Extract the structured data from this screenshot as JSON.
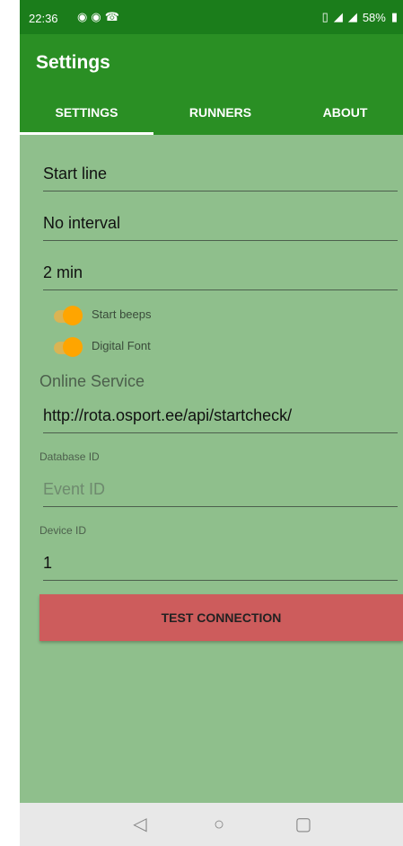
{
  "status": {
    "time": "22:36",
    "battery": "58%",
    "icons_left": [
      "messenger-icon",
      "messenger-icon",
      "missed-call-icon"
    ],
    "icons_right": [
      "vibrate-icon",
      "data-4g-icon",
      "signal-icon",
      "battery-icon"
    ]
  },
  "appbar": {
    "title": "Settings",
    "tabs": [
      {
        "label": "SETTINGS",
        "selected": true
      },
      {
        "label": "RUNNERS",
        "selected": false
      },
      {
        "label": "ABOUT",
        "selected": false
      }
    ]
  },
  "settings": {
    "start_line": "Start line",
    "interval": "No interval",
    "duration": "2 min",
    "start_beeps": {
      "label": "Start beeps",
      "on": true
    },
    "digital_font": {
      "label": "Digital Font",
      "on": true
    },
    "online_service_label": "Online Service",
    "online_service_url": "http://rota.osport.ee/api/startcheck/",
    "database_id_label": "Database ID",
    "event_id_placeholder": "Event ID",
    "device_id_label": "Device ID",
    "device_id_value": "1",
    "test_button": "TEST CONNECTION"
  },
  "colors": {
    "statusbar": "#1b7d1b",
    "appbar": "#2a8f24",
    "background": "#8fbf8c",
    "toggle": "#ffa500",
    "button": "#cd5c5c"
  }
}
